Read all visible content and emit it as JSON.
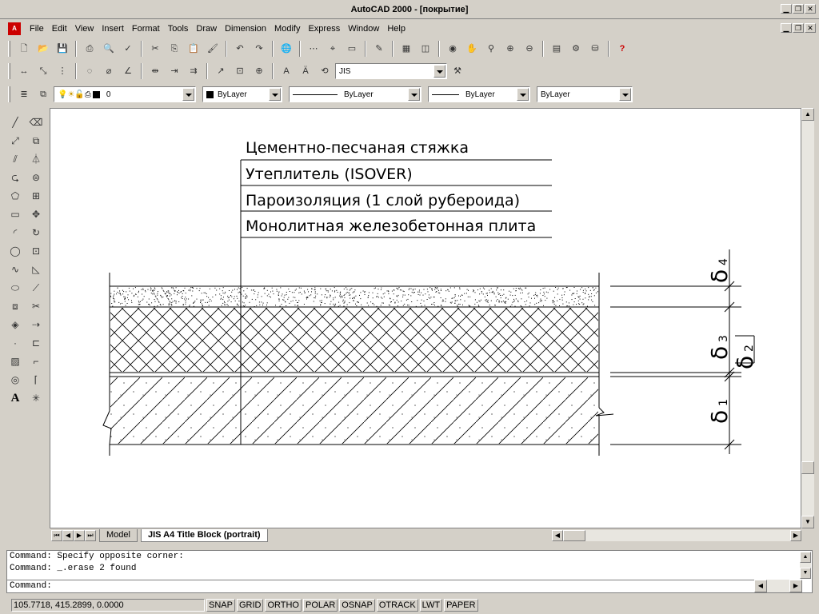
{
  "window": {
    "title": "AutoCAD 2000 - [покрытие]"
  },
  "menu": [
    "File",
    "Edit",
    "View",
    "Insert",
    "Format",
    "Tools",
    "Draw",
    "Dimension",
    "Modify",
    "Express",
    "Window",
    "Help"
  ],
  "toolbar_dim": {
    "dimstyle_value": "JIS"
  },
  "properties_bar": {
    "layer_value": "0",
    "color_value": "ByLayer",
    "linetype_value": "ByLayer",
    "lineweight_value": "ByLayer",
    "plotstyle_value": "ByLayer"
  },
  "drawing": {
    "labels": [
      "Цементно-песчаная стяжка",
      "Утеплитель (ISOVER)",
      "Пароизоляция (1 слой рубероида)",
      "Монолитная железобетонная плита"
    ],
    "dimensions": [
      {
        "symbol": "δ",
        "sub": "4"
      },
      {
        "symbol": "δ",
        "sub": "3"
      },
      {
        "symbol": "δ",
        "sub": "2"
      },
      {
        "symbol": "δ",
        "sub": "1"
      }
    ]
  },
  "layout_tabs": {
    "tabs": [
      "Model",
      "JIS A4 Title Block (portrait)"
    ],
    "active": "JIS A4 Title Block (portrait)"
  },
  "command_window": {
    "history": [
      "Command: Specify opposite corner:",
      "Command: _.erase 2 found"
    ],
    "prompt": "Command:"
  },
  "status_bar": {
    "coordinates": "105.7718, 415.2899, 0.0000",
    "toggles": [
      "SNAP",
      "GRID",
      "ORTHO",
      "POLAR",
      "OSNAP",
      "OTRACK",
      "LWT",
      "PAPER"
    ]
  }
}
